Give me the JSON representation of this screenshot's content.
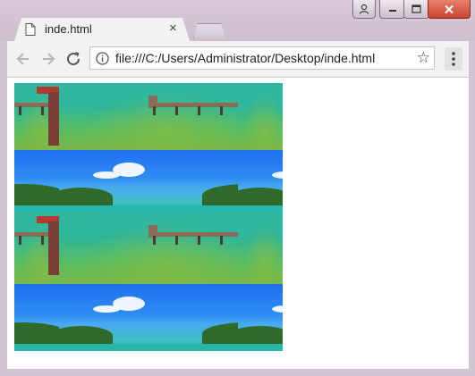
{
  "browser": {
    "tab": {
      "title": "inde.html",
      "close_glyph": "×"
    },
    "address": {
      "url": "file:///C:/Users/Administrator/Desktop/inde.html"
    },
    "icons": {
      "page": "page-icon",
      "back": "back-arrow-icon",
      "forward": "forward-arrow-icon",
      "reload": "reload-icon",
      "info": "info-icon",
      "star": "star-icon",
      "menu": "kebab-menu-icon",
      "user": "user-icon",
      "minimize": "minimize-icon",
      "maximize": "maximize-icon",
      "close": "close-icon"
    }
  },
  "content": {
    "background_image": "repeating tiled beach/pier photo (no text)"
  },
  "colors": {
    "titlebar": "#d9c8d8",
    "toolbar": "#f2f2f2",
    "close_button": "#c9432d"
  }
}
